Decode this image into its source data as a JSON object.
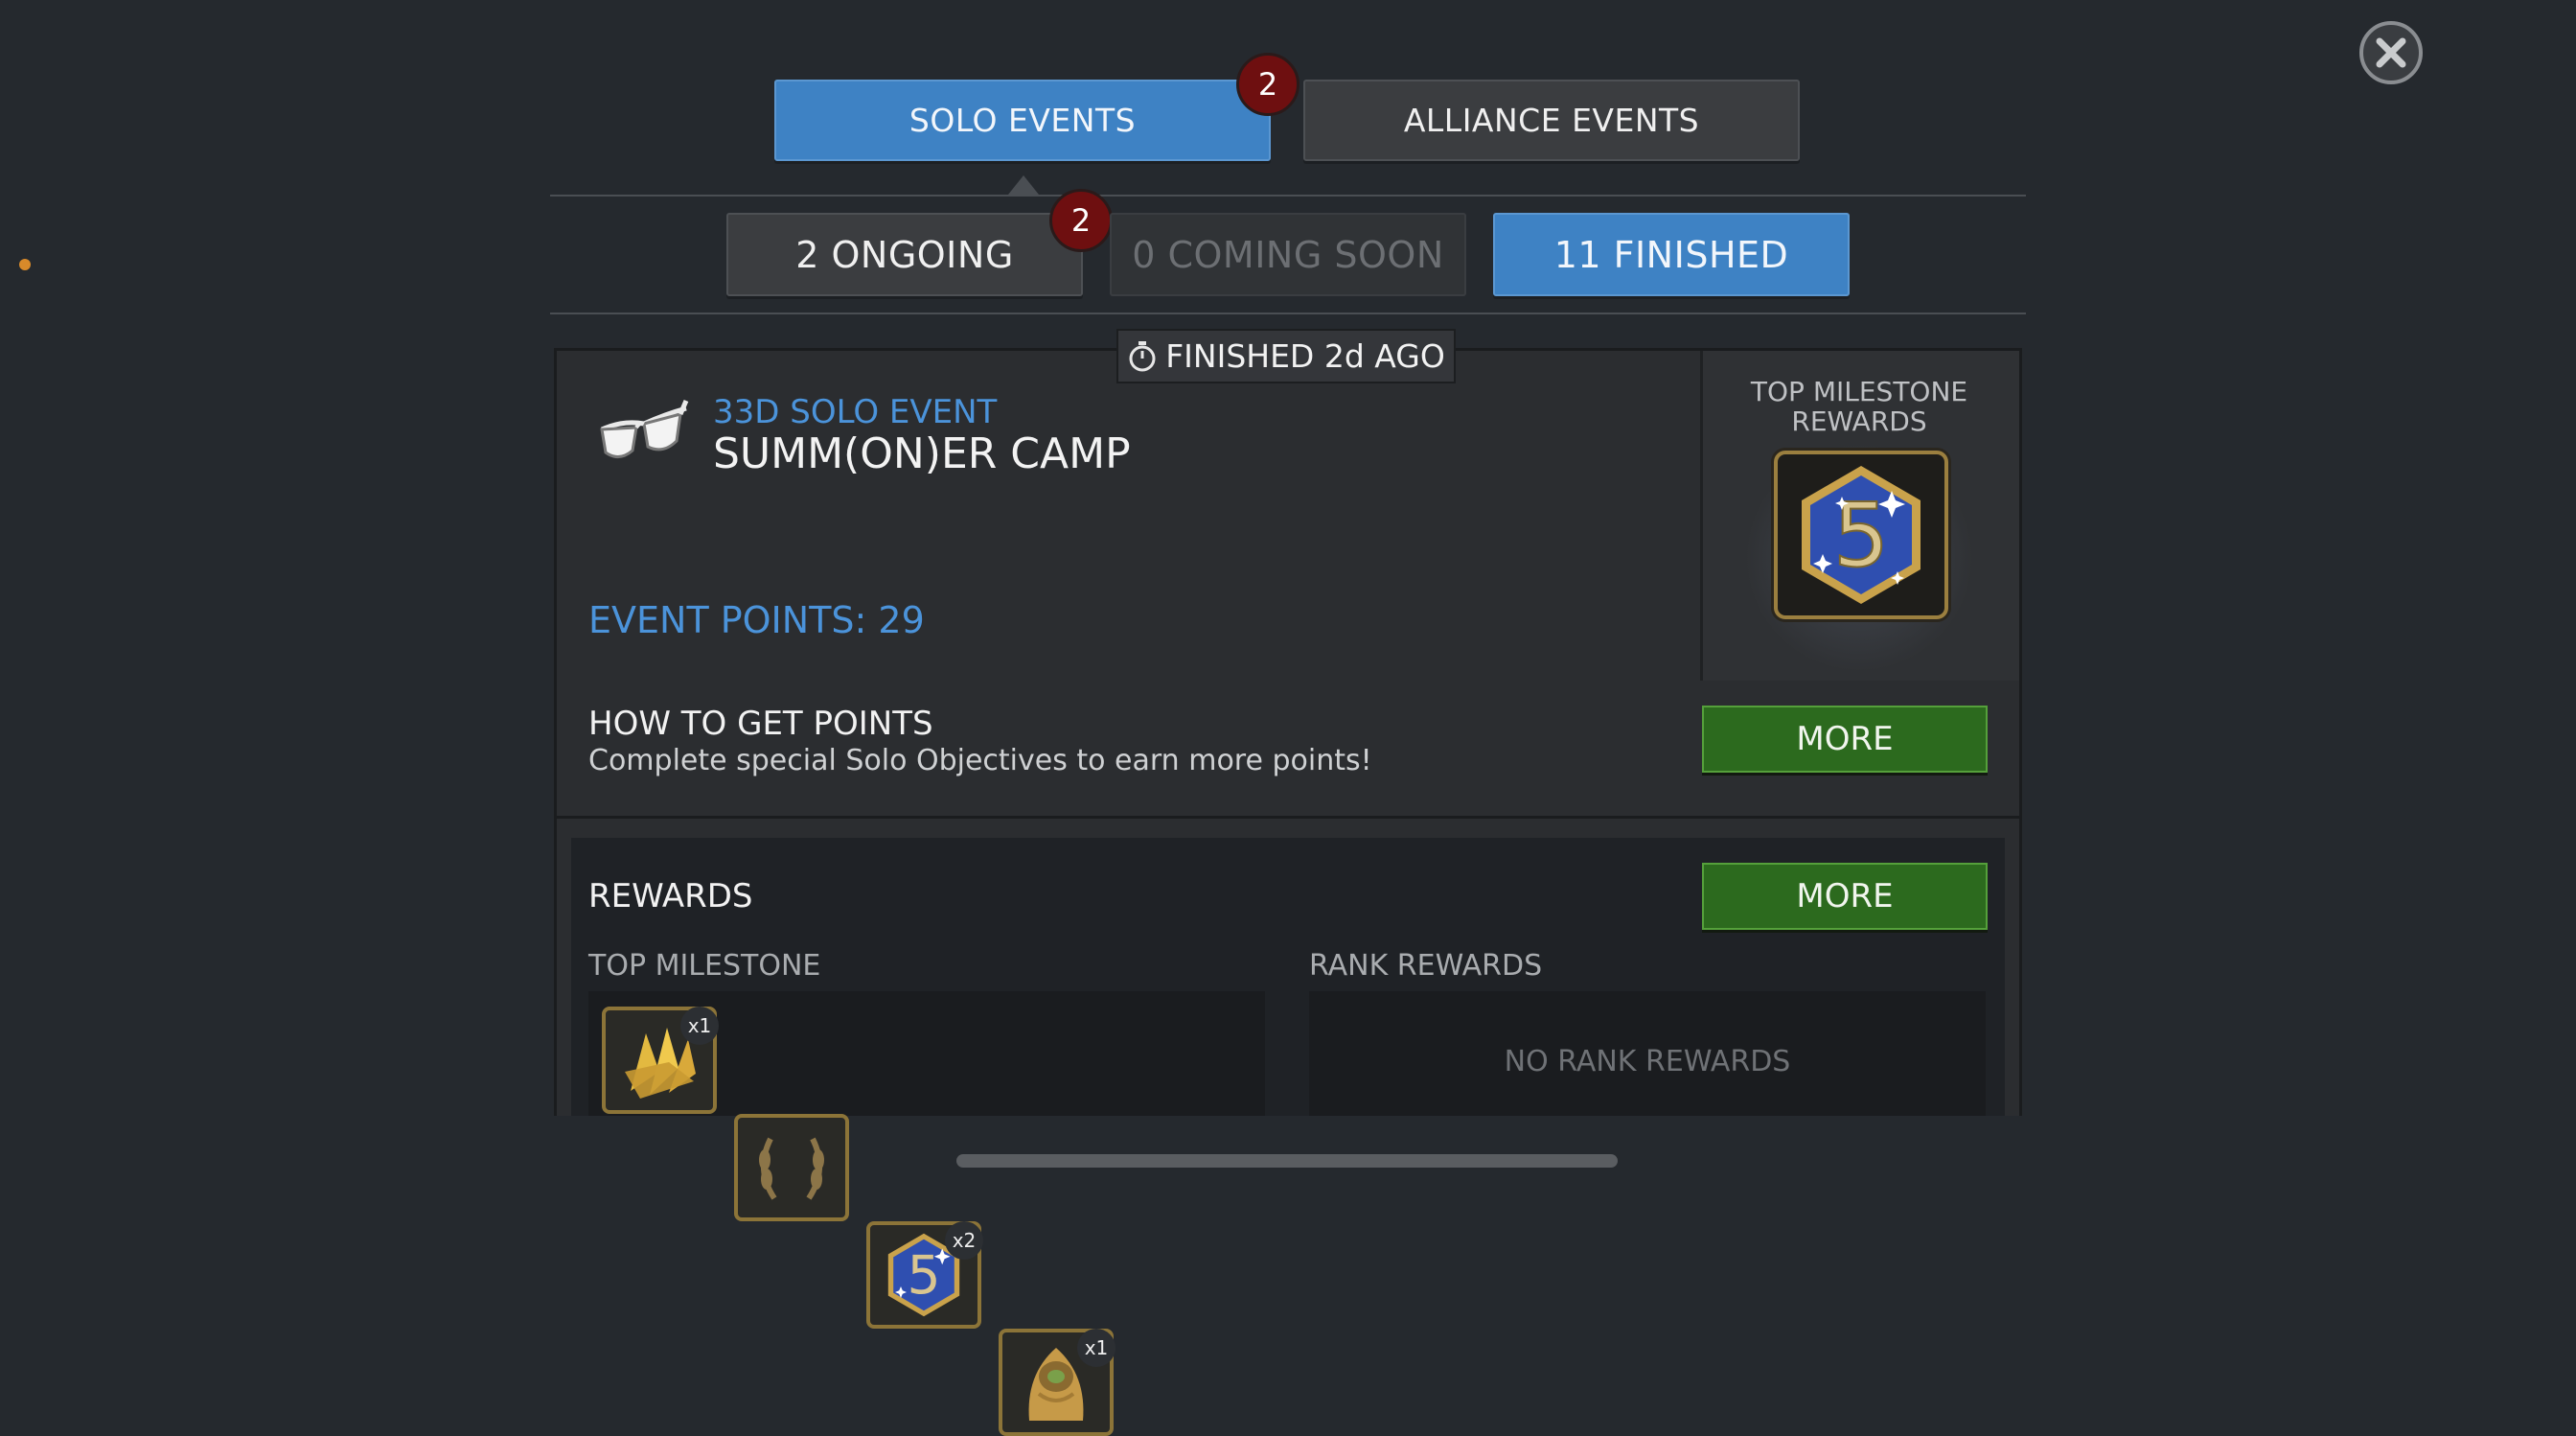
{
  "top_tabs": {
    "solo": "SOLO EVENTS",
    "solo_badge": "2",
    "alliance": "ALLIANCE EVENTS"
  },
  "sub_tabs": {
    "ongoing": "2 ONGOING",
    "ongoing_badge": "2",
    "coming_soon": "0 COMING SOON",
    "finished": "11 FINISHED"
  },
  "event": {
    "status": "FINISHED 2d AGO",
    "type": "33D SOLO EVENT",
    "name": "SUMM(ON)ER CAMP",
    "points": "EVENT POINTS: 29",
    "top_milestone_label": "TOP MILESTONE REWARDS",
    "top_milestone_value": "5"
  },
  "points_section": {
    "title": "HOW TO GET POINTS",
    "description": "Complete special Solo Objectives to earn more points!",
    "more": "MORE"
  },
  "rewards": {
    "title": "REWARDS",
    "more": "MORE",
    "milestone_label": "TOP MILESTONE",
    "rank_label": "RANK REWARDS",
    "no_rank": "NO RANK REWARDS",
    "items": [
      {
        "icon": "shards-icon",
        "qty": "x1"
      },
      {
        "icon": "laurel-wreath-icon",
        "qty": ""
      },
      {
        "icon": "five-star-crystal-icon",
        "qty": "x2",
        "value": "5"
      },
      {
        "icon": "champion-crystal-icon",
        "qty": "x1"
      }
    ]
  },
  "colors": {
    "accent_blue": "#3e82c4",
    "text_blue": "#4b93da",
    "green": "#2c6a1e",
    "badge_red": "#6e0f10"
  }
}
